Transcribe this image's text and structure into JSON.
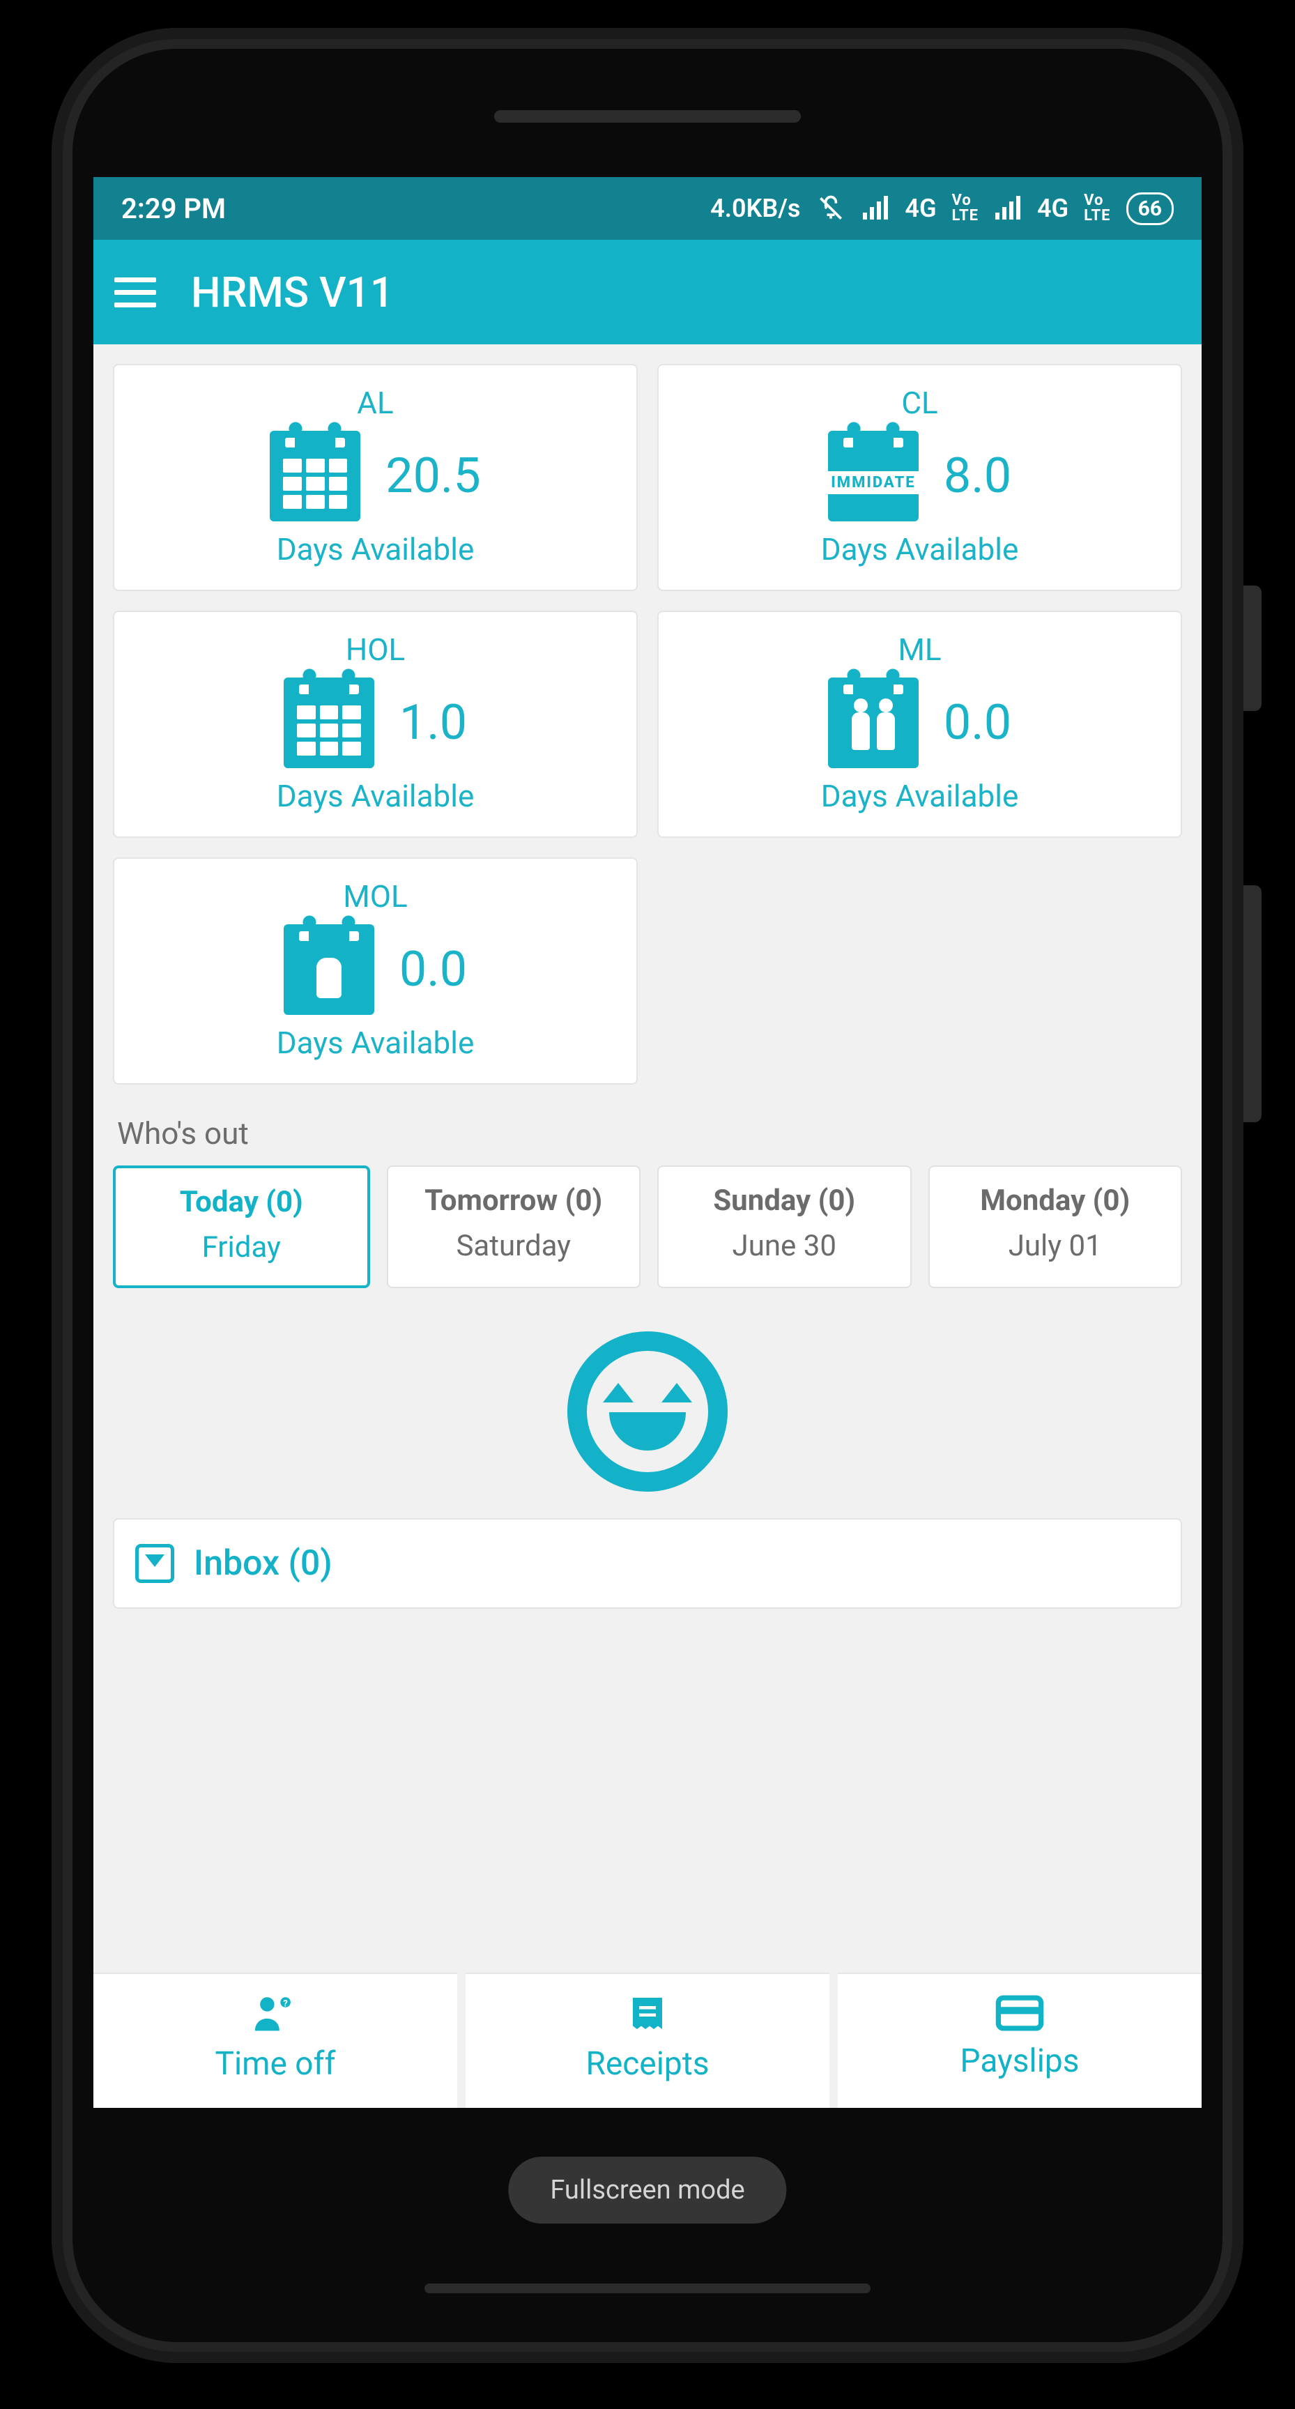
{
  "statusbar": {
    "time": "2:29 PM",
    "net_speed": "4.0KB/s",
    "signal1_label": "4G",
    "signal2_label": "4G",
    "volte": "VoLTE",
    "battery": "66"
  },
  "appbar": {
    "title": "HRMS V11"
  },
  "leave_cards": [
    {
      "code": "AL",
      "value": "20.5",
      "caption": "Days Available",
      "icon": "calendar-grid"
    },
    {
      "code": "CL",
      "value": "8.0",
      "caption": "Days Available",
      "icon": "calendar-immediate"
    },
    {
      "code": "HOL",
      "value": "1.0",
      "caption": "Days Available",
      "icon": "calendar-grid"
    },
    {
      "code": "ML",
      "value": "0.0",
      "caption": "Days Available",
      "icon": "calendar-couple"
    },
    {
      "code": "MOL",
      "value": "0.0",
      "caption": "Days Available",
      "icon": "calendar-person"
    }
  ],
  "whos_out": {
    "title": "Who's out",
    "days": [
      {
        "top": "Today (0)",
        "bottom": "Friday",
        "active": true
      },
      {
        "top": "Tomorrow (0)",
        "bottom": "Saturday",
        "active": false
      },
      {
        "top": "Sunday (0)",
        "bottom": "June 30",
        "active": false
      },
      {
        "top": "Monday (0)",
        "bottom": "July 01",
        "active": false
      }
    ]
  },
  "inbox": {
    "label": "Inbox (0)"
  },
  "bottom_nav": [
    {
      "label": "Time off",
      "icon": "people-icon"
    },
    {
      "label": "Receipts",
      "icon": "receipt-icon"
    },
    {
      "label": "Payslips",
      "icon": "card-icon"
    }
  ],
  "system": {
    "fullscreen_pill": "Fullscreen mode"
  },
  "cl_tag": "IMMIDATE"
}
